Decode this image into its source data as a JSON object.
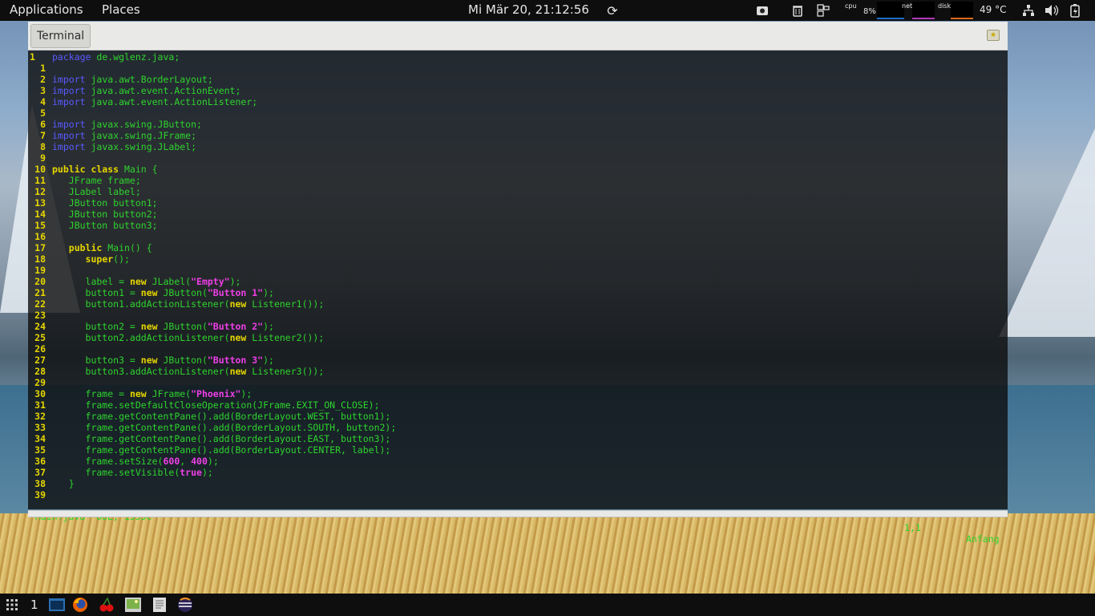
{
  "top_panel": {
    "applications": "Applications",
    "places": "Places",
    "clock": "Mi Mär 20, 21:12:56",
    "cpu_label": "cpu",
    "cpu_value": "8%",
    "net_label": "net",
    "disk_label": "disk",
    "temperature": "49 °C"
  },
  "terminal": {
    "tab_label": "Terminal",
    "status": {
      "file": "\"Main.java\" 68L, 1535C",
      "position": "1,1",
      "scroll": "Anfang"
    },
    "lines": [
      {
        "n": "1",
        "first": true,
        "t": [
          [
            "kw",
            "package"
          ],
          [
            "p",
            " de.wglenz.java;"
          ]
        ]
      },
      {
        "n": "1",
        "t": []
      },
      {
        "n": "2",
        "t": [
          [
            "kw",
            "import"
          ],
          [
            "p",
            " java.awt.BorderLayout;"
          ]
        ]
      },
      {
        "n": "3",
        "t": [
          [
            "kw",
            "import"
          ],
          [
            "p",
            " java.awt.event.ActionEvent;"
          ]
        ]
      },
      {
        "n": "4",
        "t": [
          [
            "kw",
            "import"
          ],
          [
            "p",
            " java.awt.event.ActionListener;"
          ]
        ]
      },
      {
        "n": "5",
        "t": []
      },
      {
        "n": "6",
        "t": [
          [
            "kw",
            "import"
          ],
          [
            "p",
            " javax.swing.JButton;"
          ]
        ]
      },
      {
        "n": "7",
        "t": [
          [
            "kw",
            "import"
          ],
          [
            "p",
            " javax.swing.JFrame;"
          ]
        ]
      },
      {
        "n": "8",
        "t": [
          [
            "kw",
            "import"
          ],
          [
            "p",
            " javax.swing.JLabel;"
          ]
        ]
      },
      {
        "n": "9",
        "t": []
      },
      {
        "n": "10",
        "t": [
          [
            "kw2",
            "public class"
          ],
          [
            "p",
            " Main {"
          ]
        ]
      },
      {
        "n": "11",
        "t": [
          [
            "p",
            "   JFrame frame;"
          ]
        ]
      },
      {
        "n": "12",
        "t": [
          [
            "p",
            "   JLabel label;"
          ]
        ]
      },
      {
        "n": "13",
        "t": [
          [
            "p",
            "   JButton button1;"
          ]
        ]
      },
      {
        "n": "14",
        "t": [
          [
            "p",
            "   JButton button2;"
          ]
        ]
      },
      {
        "n": "15",
        "t": [
          [
            "p",
            "   JButton button3;"
          ]
        ]
      },
      {
        "n": "16",
        "t": []
      },
      {
        "n": "17",
        "t": [
          [
            "p",
            "   "
          ],
          [
            "kw2",
            "public"
          ],
          [
            "p",
            " Main() {"
          ]
        ]
      },
      {
        "n": "18",
        "t": [
          [
            "p",
            "      "
          ],
          [
            "kw2",
            "super"
          ],
          [
            "p",
            "();"
          ]
        ]
      },
      {
        "n": "19",
        "t": []
      },
      {
        "n": "20",
        "t": [
          [
            "p",
            "      label = "
          ],
          [
            "kw2",
            "new"
          ],
          [
            "p",
            " JLabel("
          ],
          [
            "str",
            "\"Empty\""
          ],
          [
            "p",
            ");"
          ]
        ]
      },
      {
        "n": "21",
        "t": [
          [
            "p",
            "      button1 = "
          ],
          [
            "kw2",
            "new"
          ],
          [
            "p",
            " JButton("
          ],
          [
            "str",
            "\"Button 1\""
          ],
          [
            "p",
            ");"
          ]
        ]
      },
      {
        "n": "22",
        "t": [
          [
            "p",
            "      button1.addActionListener("
          ],
          [
            "kw2",
            "new"
          ],
          [
            "p",
            " Listener1());"
          ]
        ]
      },
      {
        "n": "23",
        "t": []
      },
      {
        "n": "24",
        "t": [
          [
            "p",
            "      button2 = "
          ],
          [
            "kw2",
            "new"
          ],
          [
            "p",
            " JButton("
          ],
          [
            "str",
            "\"Button 2\""
          ],
          [
            "p",
            ");"
          ]
        ]
      },
      {
        "n": "25",
        "t": [
          [
            "p",
            "      button2.addActionListener("
          ],
          [
            "kw2",
            "new"
          ],
          [
            "p",
            " Listener2());"
          ]
        ]
      },
      {
        "n": "26",
        "t": []
      },
      {
        "n": "27",
        "t": [
          [
            "p",
            "      button3 = "
          ],
          [
            "kw2",
            "new"
          ],
          [
            "p",
            " JButton("
          ],
          [
            "str",
            "\"Button 3\""
          ],
          [
            "p",
            ");"
          ]
        ]
      },
      {
        "n": "28",
        "t": [
          [
            "p",
            "      button3.addActionListener("
          ],
          [
            "kw2",
            "new"
          ],
          [
            "p",
            " Listener3());"
          ]
        ]
      },
      {
        "n": "29",
        "t": []
      },
      {
        "n": "30",
        "t": [
          [
            "p",
            "      frame = "
          ],
          [
            "kw2",
            "new"
          ],
          [
            "p",
            " JFrame("
          ],
          [
            "str",
            "\"Phoenix\""
          ],
          [
            "p",
            ");"
          ]
        ]
      },
      {
        "n": "31",
        "t": [
          [
            "p",
            "      frame.setDefaultCloseOperation(JFrame.EXIT_ON_CLOSE);"
          ]
        ]
      },
      {
        "n": "32",
        "t": [
          [
            "p",
            "      frame.getContentPane().add(BorderLayout.WEST, button1);"
          ]
        ]
      },
      {
        "n": "33",
        "t": [
          [
            "p",
            "      frame.getContentPane().add(BorderLayout.SOUTH, button2);"
          ]
        ]
      },
      {
        "n": "34",
        "t": [
          [
            "p",
            "      frame.getContentPane().add(BorderLayout.EAST, button3);"
          ]
        ]
      },
      {
        "n": "35",
        "t": [
          [
            "p",
            "      frame.getContentPane().add(BorderLayout.CENTER, label);"
          ]
        ]
      },
      {
        "n": "36",
        "t": [
          [
            "p",
            "      frame.setSize("
          ],
          [
            "num",
            "600"
          ],
          [
            "p",
            ", "
          ],
          [
            "num",
            "400"
          ],
          [
            "p",
            ");"
          ]
        ]
      },
      {
        "n": "37",
        "t": [
          [
            "p",
            "      frame.setVisible("
          ],
          [
            "num",
            "true"
          ],
          [
            "p",
            ");"
          ]
        ]
      },
      {
        "n": "38",
        "t": [
          [
            "p",
            "   }"
          ]
        ]
      },
      {
        "n": "39",
        "t": []
      }
    ]
  },
  "bottom_panel": {
    "workspace": "1"
  },
  "colors": {
    "panel_bg": "#0e0e0e",
    "code_green": "#2ed42e",
    "line_number_yellow": "#e6d600",
    "keyword_blue": "#5a5aff",
    "string_magenta": "#ee3fe7"
  }
}
